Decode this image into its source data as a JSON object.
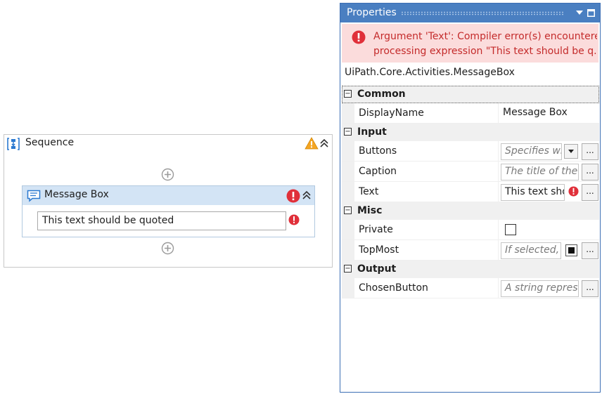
{
  "designer": {
    "sequence": {
      "title": "Sequence"
    },
    "message_box": {
      "title": "Message Box",
      "text_value": "This text should be quoted"
    }
  },
  "properties": {
    "title": "Properties",
    "error": {
      "line1": "Argument 'Text': Compiler error(s) encountered",
      "line2": "processing expression \"This text should be q..."
    },
    "type_name": "UiPath.Core.Activities.MessageBox",
    "categories": {
      "common": "Common",
      "input": "Input",
      "misc": "Misc",
      "output": "Output"
    },
    "rows": {
      "displayname": {
        "name": "DisplayName",
        "value": "Message Box"
      },
      "buttons": {
        "name": "Buttons",
        "placeholder": "Specifies wh"
      },
      "caption": {
        "name": "Caption",
        "placeholder": "The title of the"
      },
      "text": {
        "name": "Text",
        "value": "This text sho"
      },
      "private": {
        "name": "Private"
      },
      "topmost": {
        "name": "TopMost",
        "placeholder": "If selected, t"
      },
      "chosenbutton": {
        "name": "ChosenButton",
        "placeholder": "A string represe"
      }
    },
    "ellipsis_label": "..."
  },
  "colors": {
    "titlebar": "#4a7fc1",
    "error_bg": "#fbdcdc",
    "error_text": "#c42b2b",
    "error_icon": "#e0303a",
    "warning_icon": "#f5a623",
    "activity_header": "#d3e4f5",
    "sequence_icon": "#2b79d0"
  },
  "icons": {
    "sequence": "sequence-icon",
    "warning": "warning-icon",
    "collapse": "double-chevron-up-icon",
    "add": "plus-circle-icon",
    "message": "message-box-icon",
    "error": "error-icon",
    "dropdown": "chevron-down-icon",
    "maximize": "maximize-icon"
  }
}
